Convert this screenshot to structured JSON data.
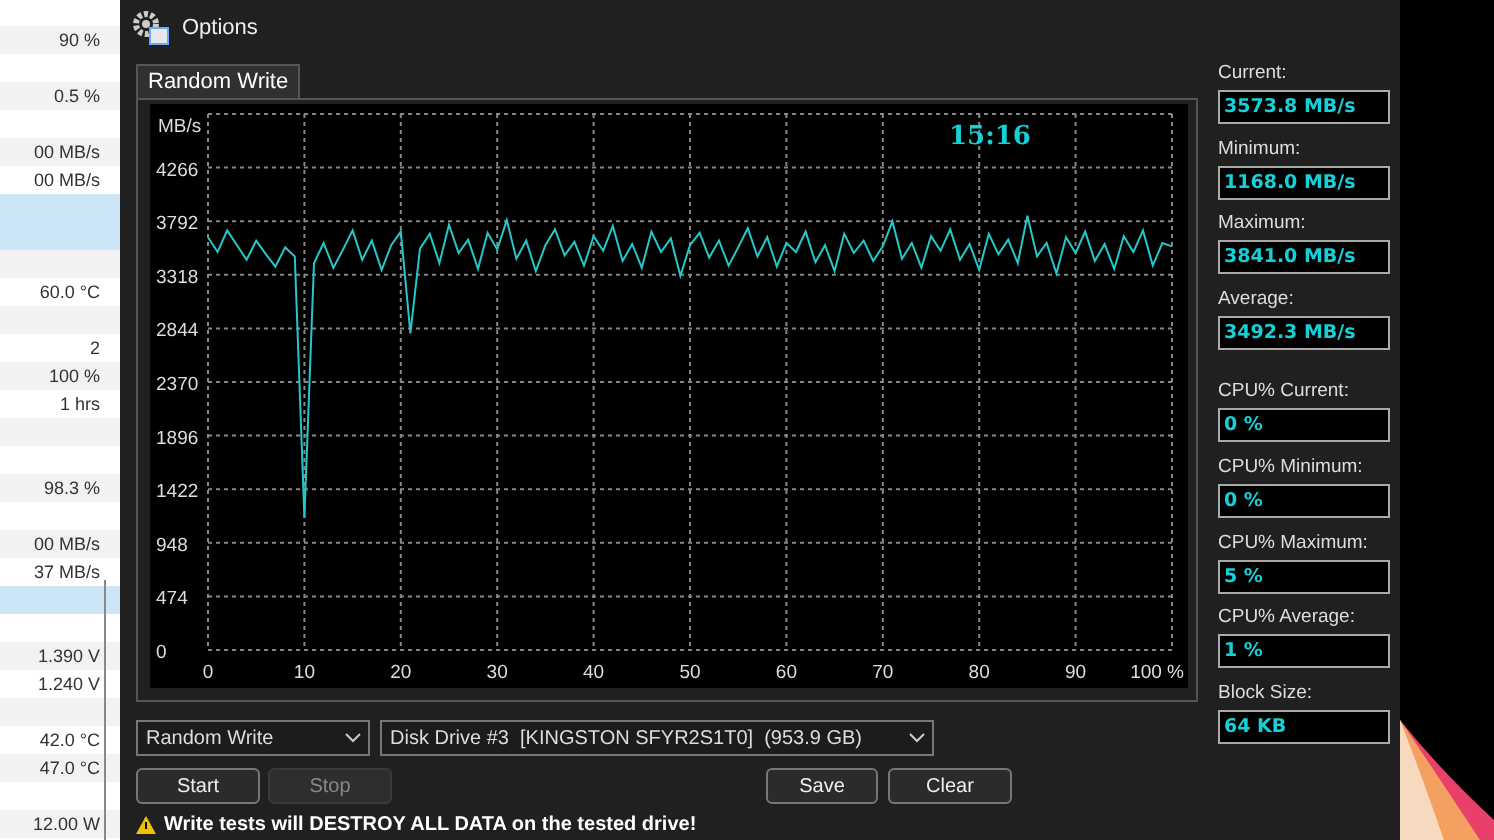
{
  "background_window": {
    "rows": [
      {
        "selected": false
      },
      {
        "value": "90 %",
        "selected": false
      },
      {
        "selected": false
      },
      {
        "value": "0.5 %",
        "selected": false
      },
      {
        "selected": false
      },
      {
        "value": "00 MB/s",
        "selected": false
      },
      {
        "value": "00 MB/s",
        "selected": false
      },
      {
        "selected": true
      },
      {
        "selected": true
      },
      {
        "selected": false
      },
      {
        "value": "60.0 °C",
        "selected": false
      },
      {
        "selected": false
      },
      {
        "value": "2",
        "selected": false
      },
      {
        "value": "100 %",
        "selected": false
      },
      {
        "value": "1 hrs",
        "selected": false
      },
      {
        "selected": false
      },
      {
        "selected": false
      },
      {
        "value": "98.3 %",
        "selected": false
      },
      {
        "selected": false
      },
      {
        "value": "00 MB/s",
        "selected": false
      },
      {
        "value": "37 MB/s",
        "selected": false
      },
      {
        "selected": true
      },
      {
        "selected": false
      },
      {
        "value": "1.390 V",
        "selected": false
      },
      {
        "value": "1.240 V",
        "selected": false
      },
      {
        "selected": false
      },
      {
        "value": "42.0 °C",
        "selected": false
      },
      {
        "value": "47.0 °C",
        "selected": false
      },
      {
        "selected": false
      },
      {
        "value": "12.00 W",
        "selected": false
      }
    ]
  },
  "window": {
    "title": "Options"
  },
  "tabs": [
    {
      "label": "Random Write",
      "selected": true
    }
  ],
  "chart": {
    "elapsed_time": "15:16",
    "chart_data": {
      "type": "line",
      "ylabel": "MB/s",
      "x": [
        0,
        1,
        2,
        3,
        4,
        5,
        6,
        7,
        8,
        9,
        10,
        11,
        12,
        13,
        14,
        15,
        16,
        17,
        18,
        19,
        20,
        21,
        22,
        23,
        24,
        25,
        26,
        27,
        28,
        29,
        30,
        31,
        32,
        33,
        34,
        35,
        36,
        37,
        38,
        39,
        40,
        41,
        42,
        43,
        44,
        45,
        46,
        47,
        48,
        49,
        50,
        51,
        52,
        53,
        54,
        55,
        56,
        57,
        58,
        59,
        60,
        61,
        62,
        63,
        64,
        65,
        66,
        67,
        68,
        69,
        70,
        71,
        72,
        73,
        74,
        75,
        76,
        77,
        78,
        79,
        80,
        81,
        82,
        83,
        84,
        85,
        86,
        87,
        88,
        89,
        90,
        91,
        92,
        93,
        94,
        95,
        96,
        97,
        98,
        99,
        100
      ],
      "grid": true,
      "series": [
        {
          "color": "#25c8c8",
          "values": [
            3650,
            3520,
            3710,
            3580,
            3450,
            3620,
            3500,
            3390,
            3560,
            3480,
            1170,
            3420,
            3600,
            3380,
            3540,
            3710,
            3450,
            3620,
            3360,
            3580,
            3700,
            2800,
            3550,
            3680,
            3420,
            3760,
            3510,
            3630,
            3370,
            3690,
            3540,
            3800,
            3460,
            3620,
            3350,
            3580,
            3720,
            3490,
            3610,
            3400,
            3660,
            3530,
            3750,
            3440,
            3590,
            3380,
            3700,
            3520,
            3640,
            3310,
            3580,
            3690,
            3470,
            3620,
            3400,
            3560,
            3730,
            3480,
            3650,
            3390,
            3600,
            3520,
            3700,
            3430,
            3580,
            3350,
            3680,
            3510,
            3620,
            3440,
            3570,
            3790,
            3460,
            3600,
            3380,
            3660,
            3530,
            3720,
            3450,
            3590,
            3360,
            3680,
            3500,
            3630,
            3420,
            3840,
            3480,
            3600,
            3330,
            3650,
            3510,
            3700,
            3440,
            3590,
            3370,
            3660,
            3520,
            3710,
            3400,
            3600,
            3570
          ]
        }
      ],
      "xlim": [
        0,
        100
      ],
      "ylim": [
        0,
        4740
      ],
      "xticks": [
        0,
        10,
        20,
        30,
        40,
        50,
        60,
        70,
        80,
        90,
        {
          "value": 100,
          "label": "100 %"
        }
      ],
      "yticks": [
        0,
        474,
        948,
        1422,
        1896,
        2370,
        2844,
        3318,
        3792,
        4266
      ]
    }
  },
  "stat_groups": [
    [
      {
        "label": "Current:",
        "value": "3573.8 MB/s"
      },
      {
        "label": "Minimum:",
        "value": "1168.0 MB/s"
      },
      {
        "label": "Maximum:",
        "value": "3841.0 MB/s"
      },
      {
        "label": "Average:",
        "value": "3492.3 MB/s"
      }
    ],
    [
      {
        "label": "CPU% Current:",
        "value": "0 %"
      },
      {
        "label": "CPU% Minimum:",
        "value": "0 %"
      },
      {
        "label": "CPU% Maximum:",
        "value": "5 %"
      },
      {
        "label": "CPU% Average:",
        "value": "1 %"
      },
      {
        "label": "Block Size:",
        "value": "64 KB"
      }
    ]
  ],
  "test_select": {
    "value": "Random Write"
  },
  "drive_select": {
    "value": "Disk Drive #3  [KINGSTON SFYR2S1T0]  (953.9 GB)"
  },
  "left_buttons": [
    {
      "label": "Start",
      "disabled": false
    },
    {
      "label": "Stop",
      "disabled": true
    }
  ],
  "right_buttons": [
    {
      "label": "Save",
      "disabled": false
    },
    {
      "label": "Clear",
      "disabled": false
    }
  ],
  "warning": {
    "text": "Write tests will DESTROY ALL DATA on the tested drive!"
  }
}
